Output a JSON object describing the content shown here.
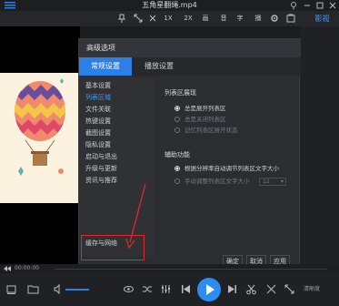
{
  "title_bar": {
    "title": "五角星翻绳.mp4"
  },
  "toolbar": {
    "items": [
      "1X",
      "2X",
      "画",
      "音",
      "字",
      "播"
    ]
  },
  "right_tab": {
    "label": "影视"
  },
  "dialog": {
    "title": "高级选项",
    "tabs": [
      {
        "label": "常规设置",
        "active": true
      },
      {
        "label": "播放设置",
        "active": false
      }
    ],
    "nav": [
      {
        "label": "基本设置"
      },
      {
        "label": "列表区域",
        "active": true
      },
      {
        "label": "文件关联"
      },
      {
        "label": "热键设置"
      },
      {
        "label": "截图设置"
      },
      {
        "label": "隐私设置"
      },
      {
        "label": "启动与退出"
      },
      {
        "label": "升级与更新"
      },
      {
        "label": "资讯与推荐"
      },
      {
        "label": "缓存与网络"
      }
    ],
    "list_section": {
      "title": "列表区展现",
      "options": [
        {
          "label": "总是展开列表区",
          "selected": true,
          "disabled": false
        },
        {
          "label": "总是关闭列表区",
          "selected": false,
          "disabled": true
        },
        {
          "label": "记忆列表区展开状态",
          "selected": false,
          "disabled": true
        }
      ]
    },
    "aux_section": {
      "title": "辅助功能",
      "options": [
        {
          "label": "根据分辨率自动调节列表区文字大小",
          "selected": true,
          "disabled": false
        },
        {
          "label": "手动调整列表区文字大小",
          "selected": false,
          "disabled": true
        }
      ],
      "font_size_value": "12"
    },
    "buttons": {
      "ok": "确定",
      "cancel": "取消",
      "apply": "应用"
    }
  },
  "player": {
    "time": "00:00:00",
    "hd_label": "清晰度"
  },
  "colors": {
    "accent": "#2d7fe6",
    "annotation": "#e0282e"
  }
}
